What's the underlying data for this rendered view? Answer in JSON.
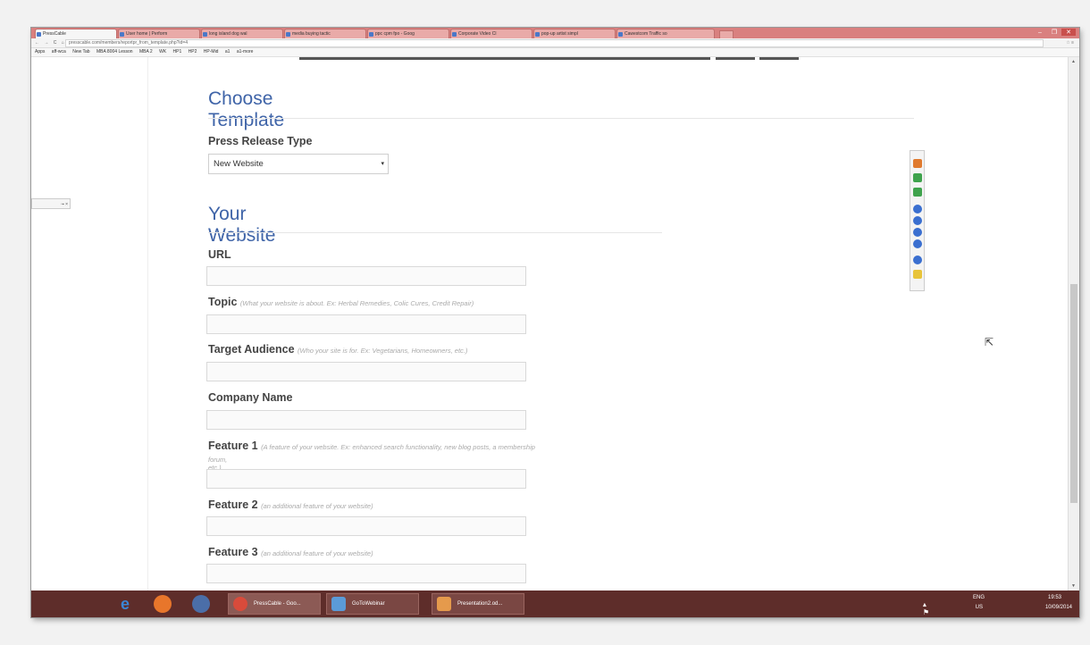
{
  "browser": {
    "tabs": [
      "PressCable",
      "User home | Perform",
      "long island dog wal",
      "media buying tactic",
      "ppc cpm fpo - Goog",
      "Corporate Video Cl",
      "pop-up artist simpl",
      "Cawestcom Traffic so"
    ],
    "window_controls": [
      "–",
      "❐",
      "✕"
    ],
    "nav": "← → C ⌂",
    "url": "presscable.com/members/reportpr_from_template.php?id=4",
    "tools": "☆ ≡",
    "bookmarks": [
      "Apps",
      "aff-wca",
      "New Tab",
      "MBA 8004 Lesson",
      "MBA 2",
      "WK",
      "HP1",
      "HP2",
      "HP-Mid",
      "a1",
      "a1-more"
    ]
  },
  "page": {
    "section1_title": "Choose Template",
    "press_release_type_label": "Press Release Type",
    "press_release_type_value": "New Website",
    "section2_title": "Your Website",
    "fields": [
      {
        "label": "URL",
        "hint": ""
      },
      {
        "label": "Topic",
        "hint": "(What your website is about. Ex: Herbal Remedies, Colic Cures, Credit Repair)"
      },
      {
        "label": "Target Audience",
        "hint": "(Who your site is for. Ex: Vegetarians, Homeowners, etc.)"
      },
      {
        "label": "Company Name",
        "hint": ""
      },
      {
        "label": "Feature 1",
        "hint": "(A feature of your website. Ex: enhanced search functionality, new blog posts, a membership",
        "hint2": "forum, etc.)"
      },
      {
        "label": "Feature 2",
        "hint": "(an additional feature of your website)"
      },
      {
        "label": "Feature 3",
        "hint": "(an additional feature of your website)"
      }
    ]
  },
  "taskbar": {
    "buttons": [
      "PressCable - Goo...",
      "GoToWebinar",
      "Presentation2.od..."
    ],
    "tray_lang": "ENG",
    "tray_region": "US",
    "time": "19:53",
    "date": "10/09/2014"
  },
  "colors": {
    "accent_title": "#3f64a8",
    "tabbar": "#d9807f",
    "taskbar": "#5e2d2a"
  }
}
